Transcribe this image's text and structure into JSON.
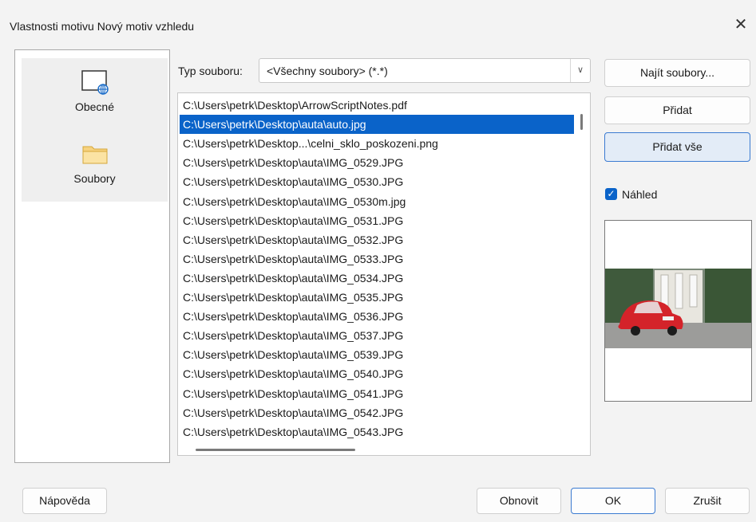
{
  "window": {
    "title": "Vlastnosti motivu Nový motiv vzhledu",
    "close_symbol": "✕"
  },
  "nav": {
    "items": [
      {
        "label": "Obecné",
        "icon": "window-globe-icon"
      },
      {
        "label": "Soubory",
        "icon": "folder-icon"
      }
    ]
  },
  "filter": {
    "label": "Typ souboru:",
    "value": "<Všechny soubory> (*.*)"
  },
  "files": [
    "C:\\Users\\petrk\\Desktop\\ArrowScriptNotes.pdf",
    "C:\\Users\\petrk\\Desktop\\auta\\auto.jpg",
    "C:\\Users\\petrk\\Desktop...\\celni_sklo_poskozeni.png",
    "C:\\Users\\petrk\\Desktop\\auta\\IMG_0529.JPG",
    "C:\\Users\\petrk\\Desktop\\auta\\IMG_0530.JPG",
    "C:\\Users\\petrk\\Desktop\\auta\\IMG_0530m.jpg",
    "C:\\Users\\petrk\\Desktop\\auta\\IMG_0531.JPG",
    "C:\\Users\\petrk\\Desktop\\auta\\IMG_0532.JPG",
    "C:\\Users\\petrk\\Desktop\\auta\\IMG_0533.JPG",
    "C:\\Users\\petrk\\Desktop\\auta\\IMG_0534.JPG",
    "C:\\Users\\petrk\\Desktop\\auta\\IMG_0535.JPG",
    "C:\\Users\\petrk\\Desktop\\auta\\IMG_0536.JPG",
    "C:\\Users\\petrk\\Desktop\\auta\\IMG_0537.JPG",
    "C:\\Users\\petrk\\Desktop\\auta\\IMG_0539.JPG",
    "C:\\Users\\petrk\\Desktop\\auta\\IMG_0540.JPG",
    "C:\\Users\\petrk\\Desktop\\auta\\IMG_0541.JPG",
    "C:\\Users\\petrk\\Desktop\\auta\\IMG_0542.JPG",
    "C:\\Users\\petrk\\Desktop\\auta\\IMG_0543.JPG"
  ],
  "selected_index": 1,
  "buttons": {
    "find_files": "Najít soubory...",
    "add": "Přidat",
    "add_all": "Přidat vše",
    "help": "Nápověda",
    "refresh": "Obnovit",
    "ok": "OK",
    "cancel": "Zrušit"
  },
  "preview": {
    "checkbox_label": "Náhled",
    "checked": true,
    "check_symbol": "✓"
  },
  "colors": {
    "selection": "#0a63c9",
    "accent_border": "#3b7bd1"
  }
}
